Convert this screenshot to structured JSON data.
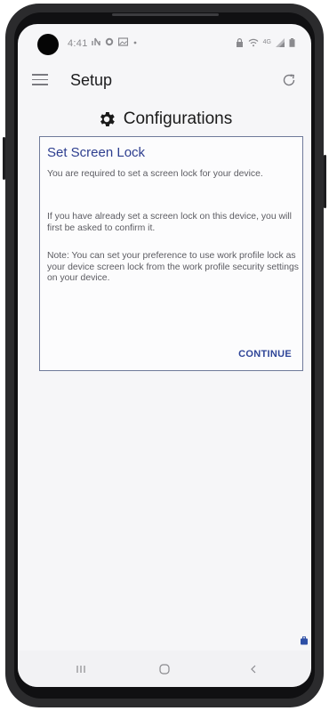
{
  "status_bar": {
    "time": "4:41",
    "left_icons": [
      "network-activity-icon",
      "settings-notification-icon",
      "image-notification-icon",
      "dot-icon"
    ],
    "right_icons": [
      "lock-icon",
      "wifi-icon",
      "lte-icon",
      "signal-icon",
      "battery-icon"
    ],
    "lte_text": "4G"
  },
  "app_bar": {
    "title": "Setup",
    "menu_icon": "hamburger-menu-icon",
    "refresh_icon": "refresh-icon"
  },
  "header": {
    "icon": "gear-icon",
    "title": "Configurations"
  },
  "card": {
    "title": "Set Screen Lock",
    "paragraphs": [
      "You are required to set a screen lock for your device.",
      "If you have already set a screen lock on this device, you will first be asked to confirm it.",
      "Note: You can set your preference to use work profile lock as your device screen lock from the work profile security settings on your device."
    ],
    "continue_label": "CONTINUE"
  },
  "colors": {
    "accent": "#2d3e8f",
    "card_border": "#6f7a9a",
    "text_body": "#5c5c62",
    "screen_bg": "#f6f6f8",
    "phone_frame": "#2b2b2d"
  },
  "nav_bar": {
    "buttons": [
      "recent-apps-icon",
      "home-icon",
      "back-icon"
    ]
  }
}
